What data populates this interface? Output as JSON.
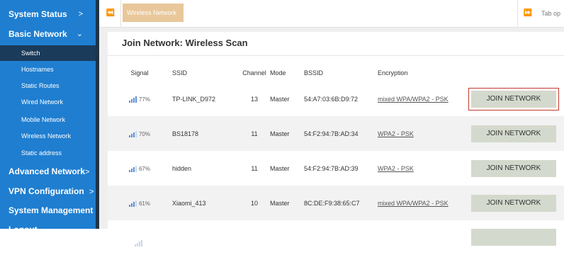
{
  "sidebar": {
    "items": [
      {
        "label": "System Status",
        "chev": ">"
      },
      {
        "label": "Basic Network",
        "chev": "⌄"
      },
      {
        "label": "Advanced Network",
        "chev": ">"
      },
      {
        "label": "VPN Configuration",
        "chev": ">"
      },
      {
        "label": "System Management"
      },
      {
        "label": "Logout"
      }
    ],
    "subitems": [
      {
        "label": "Switch",
        "active": true
      },
      {
        "label": "Hostnames"
      },
      {
        "label": "Static Routes"
      },
      {
        "label": "Wired Network"
      },
      {
        "label": "Mobile Network"
      },
      {
        "label": "Wireless Network"
      },
      {
        "label": "Static address"
      }
    ]
  },
  "tabs": {
    "nav_left": "⏪",
    "active_tab": "Wireless Network",
    "close": "✖",
    "nav_right": "⏩",
    "options": "Tab op"
  },
  "panel": {
    "title": "Join Network: Wireless Scan"
  },
  "table": {
    "headers": {
      "signal": "Signal",
      "ssid": "SSID",
      "channel": "Channel",
      "mode": "Mode",
      "bssid": "BSSID",
      "encryption": "Encryption"
    },
    "rows": [
      {
        "signal": "77%",
        "ssid": "TP-LINK_D972",
        "channel": "13",
        "mode": "Master",
        "bssid": "54:A7:03:6B:D9:72",
        "encryption": "mixed WPA/WPA2 - PSK",
        "action": "JOIN NETWORK"
      },
      {
        "signal": "70%",
        "ssid": "BS18178",
        "channel": "11",
        "mode": "Master",
        "bssid": "54:F2:94:7B:AD:34",
        "encryption": "WPA2 - PSK",
        "action": "JOIN NETWORK"
      },
      {
        "signal": "67%",
        "ssid": "hidden",
        "channel": "11",
        "mode": "Master",
        "bssid": "54:F2:94:7B:AD:39",
        "encryption": "WPA2 - PSK",
        "action": "JOIN NETWORK"
      },
      {
        "signal": "61%",
        "ssid": "Xiaomi_413",
        "channel": "10",
        "mode": "Master",
        "bssid": "8C:DE:F9:38:65:C7",
        "encryption": "mixed WPA/WPA2 - PSK",
        "action": "JOIN NETWORK"
      }
    ]
  },
  "colors": {
    "sidebar": "#1f7ed0",
    "active_tab": "#e8c79a",
    "join_button": "#d4d9cd",
    "highlight": "#c0392b"
  }
}
